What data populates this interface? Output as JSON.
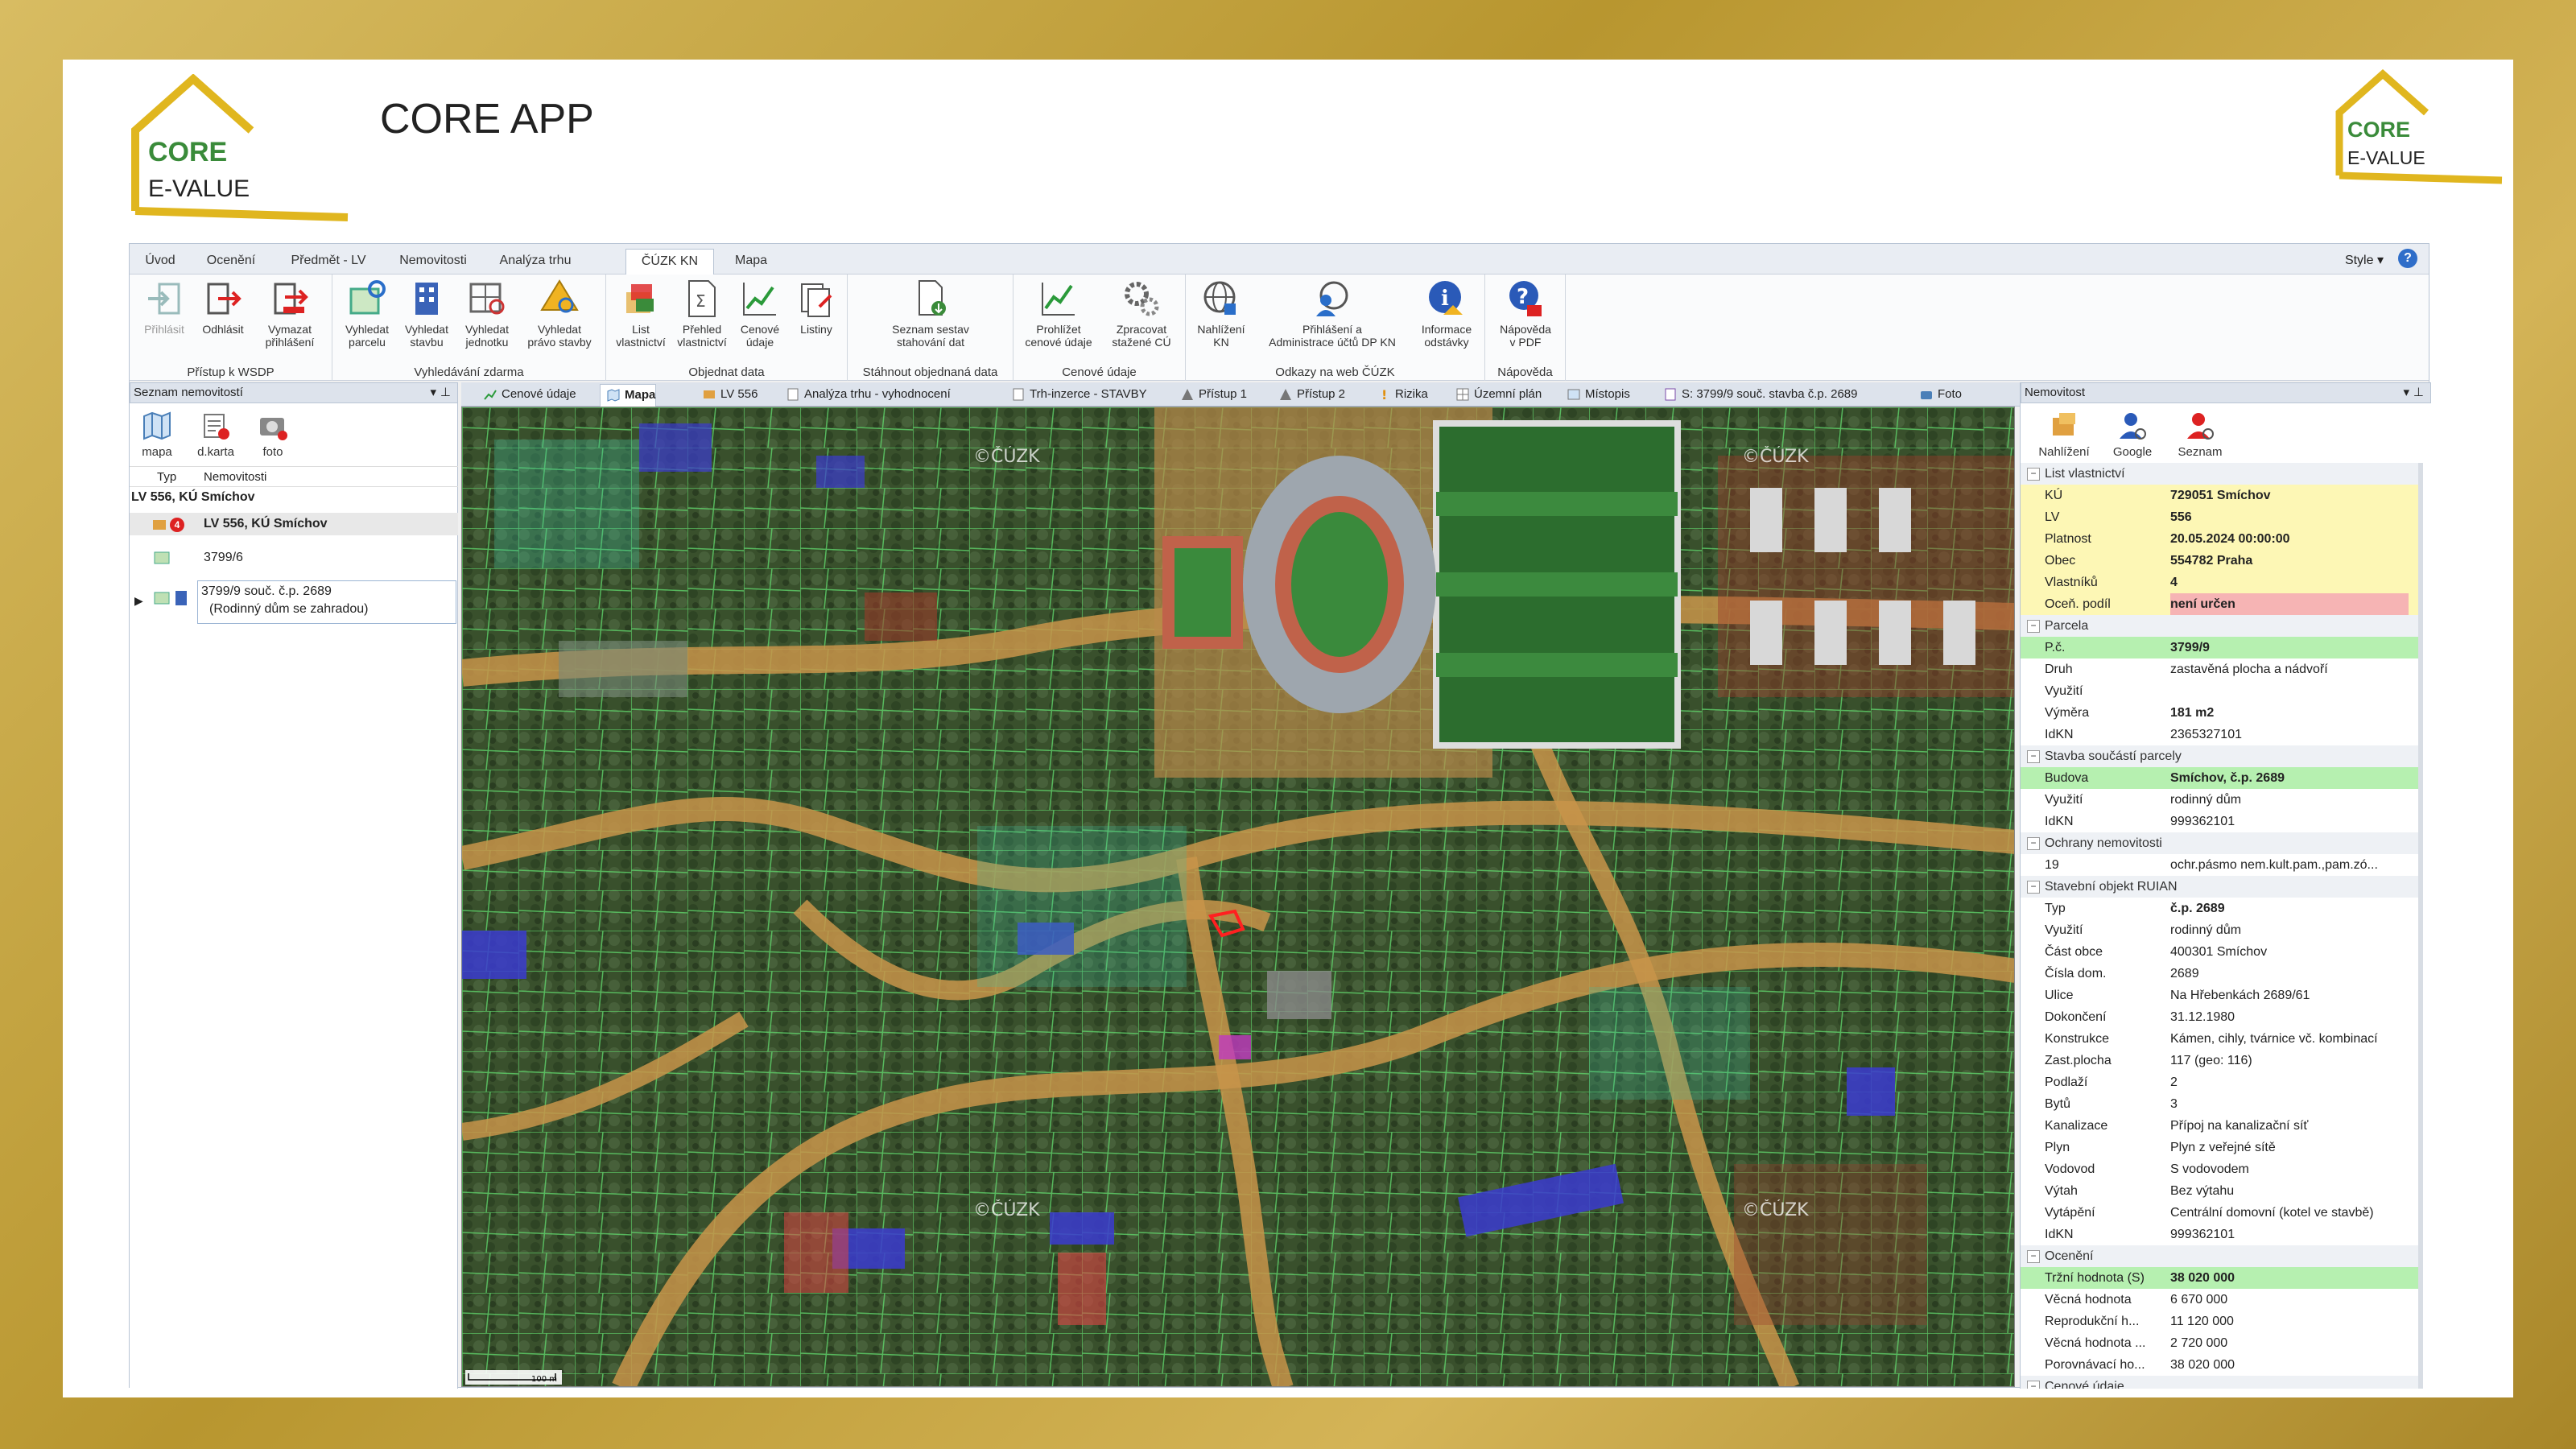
{
  "app_title": "CORE APP",
  "logo": {
    "line1": "CORE",
    "line2": "E-VALUE"
  },
  "menu_tabs": [
    "Úvod",
    "Ocenění",
    "Předmět - LV",
    "Nemovitosti",
    "Analýza trhu",
    "ČÚZK KN",
    "Mapa"
  ],
  "style_label": "Style",
  "ribbon": {
    "groups": [
      {
        "label": "Přístup k WSDP",
        "buttons": [
          "Přihlásit",
          "Odhlásit",
          "Vymazat\npřihlášení"
        ]
      },
      {
        "label": "Vyhledávání zdarma",
        "buttons": [
          "Vyhledat\nparcelu",
          "Vyhledat\nstavbu",
          "Vyhledat\njednotku",
          "Vyhledat\nprávo stavby"
        ]
      },
      {
        "label": "Objednat data",
        "buttons": [
          "List\nvlastnictví",
          "Přehled\nvlastnictví",
          "Cenové\núdaje",
          "Listiny"
        ]
      },
      {
        "label": "Stáhnout objednaná data",
        "buttons": [
          "Seznam sestav\nstahování dat"
        ]
      },
      {
        "label": "Cenové údaje",
        "buttons": [
          "Prohlížet\ncenové údaje",
          "Zpracovat\nstažené CÚ"
        ]
      },
      {
        "label": "Odkazy na web ČÚZK",
        "buttons": [
          "Nahlížení\nKN",
          "Přihlášení a\nAdministrace účtů DP KN",
          "Informace\nodstávky"
        ]
      },
      {
        "label": "Nápověda",
        "buttons": [
          "Nápověda\nv PDF"
        ]
      }
    ]
  },
  "left_panel": {
    "title": "Seznam nemovitostí",
    "buttons": [
      "mapa",
      "d.karta",
      "foto"
    ],
    "col_type": "Typ",
    "col_name": "Nemovitosti",
    "group": "LV 556, KÚ Smíchov",
    "badge": "4",
    "item_lv": "LV 556, KÚ Smíchov",
    "item_parcel": "3799/6",
    "item_building_line1": "3799/9  souč. č.p. 2689",
    "item_building_line2": "(Rodinný dům se zahradou)"
  },
  "doc_tabs": [
    "Cenové údaje",
    "Mapa",
    "LV 556",
    "Analýza trhu - vyhodnocení",
    "Trh-inzerce - STAVBY",
    "Přístup 1",
    "Přístup 2",
    "Rizika",
    "Územní plán",
    "Místopis",
    "S: 3799/9  souč. stavba č.p. 2689",
    "Foto"
  ],
  "map": {
    "watermark": "©ČÚZK",
    "scale_label": "100 m"
  },
  "right_panel": {
    "title": "Nemovitost",
    "buttons": [
      "Nahlížení",
      "Google",
      "Seznam"
    ],
    "sections": [
      {
        "title": "List vlastnictví",
        "rows": [
          {
            "k": "KÚ",
            "v": "729051  Smíchov",
            "s": "y"
          },
          {
            "k": "LV",
            "v": "556",
            "s": "y"
          },
          {
            "k": "Platnost",
            "v": "20.05.2024 00:00:00",
            "s": "y"
          },
          {
            "k": "Obec",
            "v": "554782  Praha",
            "s": "y"
          },
          {
            "k": "Vlastníků",
            "v": "4",
            "s": "y"
          },
          {
            "k": "Oceň. podíl",
            "v": "není určen",
            "s": "yp"
          }
        ]
      },
      {
        "title": "Parcela",
        "rows": [
          {
            "k": "P.č.",
            "v": "3799/9",
            "s": "g"
          },
          {
            "k": "Druh",
            "v": "zastavěná plocha a nádvoří",
            "s": ""
          },
          {
            "k": "Využití",
            "v": "",
            "s": ""
          },
          {
            "k": "Výměra",
            "v": "181  m2",
            "s": "b"
          },
          {
            "k": "IdKN",
            "v": "2365327101",
            "s": ""
          }
        ]
      },
      {
        "title": "Stavba součástí parcely",
        "rows": [
          {
            "k": "Budova",
            "v": "Smíchov, č.p. 2689",
            "s": "g"
          },
          {
            "k": "Využití",
            "v": "rodinný dům",
            "s": ""
          },
          {
            "k": "IdKN",
            "v": "999362101",
            "s": ""
          }
        ]
      },
      {
        "title": "Ochrany nemovitosti",
        "rows": [
          {
            "k": "19",
            "v": "ochr.pásmo nem.kult.pam.,pam.zó...",
            "s": ""
          }
        ]
      },
      {
        "title": "Stavební objekt RUIAN",
        "rows": [
          {
            "k": "Typ",
            "v": "č.p. 2689",
            "s": "b"
          },
          {
            "k": "Využití",
            "v": "rodinný dům",
            "s": ""
          },
          {
            "k": "Část obce",
            "v": "400301  Smíchov",
            "s": ""
          },
          {
            "k": "Čísla dom.",
            "v": "2689",
            "s": ""
          },
          {
            "k": "Ulice",
            "v": "Na Hřebenkách 2689/61",
            "s": ""
          },
          {
            "k": "Dokončení",
            "v": "31.12.1980",
            "s": ""
          },
          {
            "k": "Konstrukce",
            "v": "Kámen, cihly, tvárnice vč. kombinací",
            "s": ""
          },
          {
            "k": "Zast.plocha",
            "v": "117  (geo: 116)",
            "s": ""
          },
          {
            "k": "Podlaží",
            "v": "2",
            "s": ""
          },
          {
            "k": "Bytů",
            "v": "3",
            "s": ""
          },
          {
            "k": "Kanalizace",
            "v": "Přípoj na kanalizační síť",
            "s": ""
          },
          {
            "k": "Plyn",
            "v": "Plyn z veřejné sítě",
            "s": ""
          },
          {
            "k": "Vodovod",
            "v": "S vodovodem",
            "s": ""
          },
          {
            "k": "Výtah",
            "v": "Bez výtahu",
            "s": ""
          },
          {
            "k": "Vytápění",
            "v": "Centrální domovní (kotel ve stavbě)",
            "s": ""
          },
          {
            "k": "IdKN",
            "v": "999362101",
            "s": ""
          }
        ]
      },
      {
        "title": "Ocenění",
        "rows": [
          {
            "k": "Tržní hodnota (S)",
            "v": "38 020 000",
            "s": "g"
          },
          {
            "k": "Věcná hodnota",
            "v": "6 670 000",
            "s": ""
          },
          {
            "k": "Reprodukční h...",
            "v": "11 120 000",
            "s": ""
          },
          {
            "k": "Věcná hodnota ...",
            "v": "2 720 000",
            "s": ""
          },
          {
            "k": "Porovnávací ho...",
            "v": "38 020 000",
            "s": ""
          }
        ]
      },
      {
        "title": "Cenové údaje",
        "rows": []
      }
    ]
  },
  "colors": {
    "brand_yellow": "#e0b61f",
    "brand_green": "#3a8b3a",
    "ribbon_blue": "#dde3ec"
  }
}
